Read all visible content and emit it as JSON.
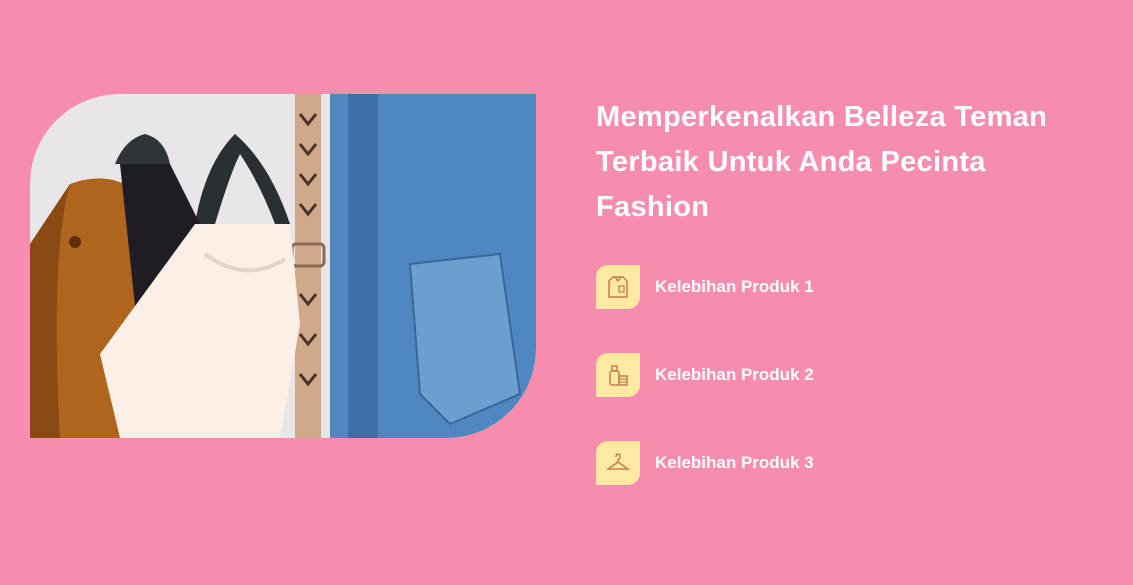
{
  "hero": {
    "heading": "Memperkenalkan Belleza Teman Terbaik Untuk Anda Pecinta Fashion",
    "image_alt": "clothes-on-rack-photo"
  },
  "features": [
    {
      "label": "Kelebihan Produk 1",
      "icon": "shirt-icon"
    },
    {
      "label": "Kelebihan Produk 2",
      "icon": "bottle-icon"
    },
    {
      "label": "Kelebihan Produk 3",
      "icon": "hanger-icon"
    }
  ],
  "colors": {
    "background": "#f78dae",
    "icon_bg": "#ffe9a3",
    "text": "#ffffff"
  }
}
